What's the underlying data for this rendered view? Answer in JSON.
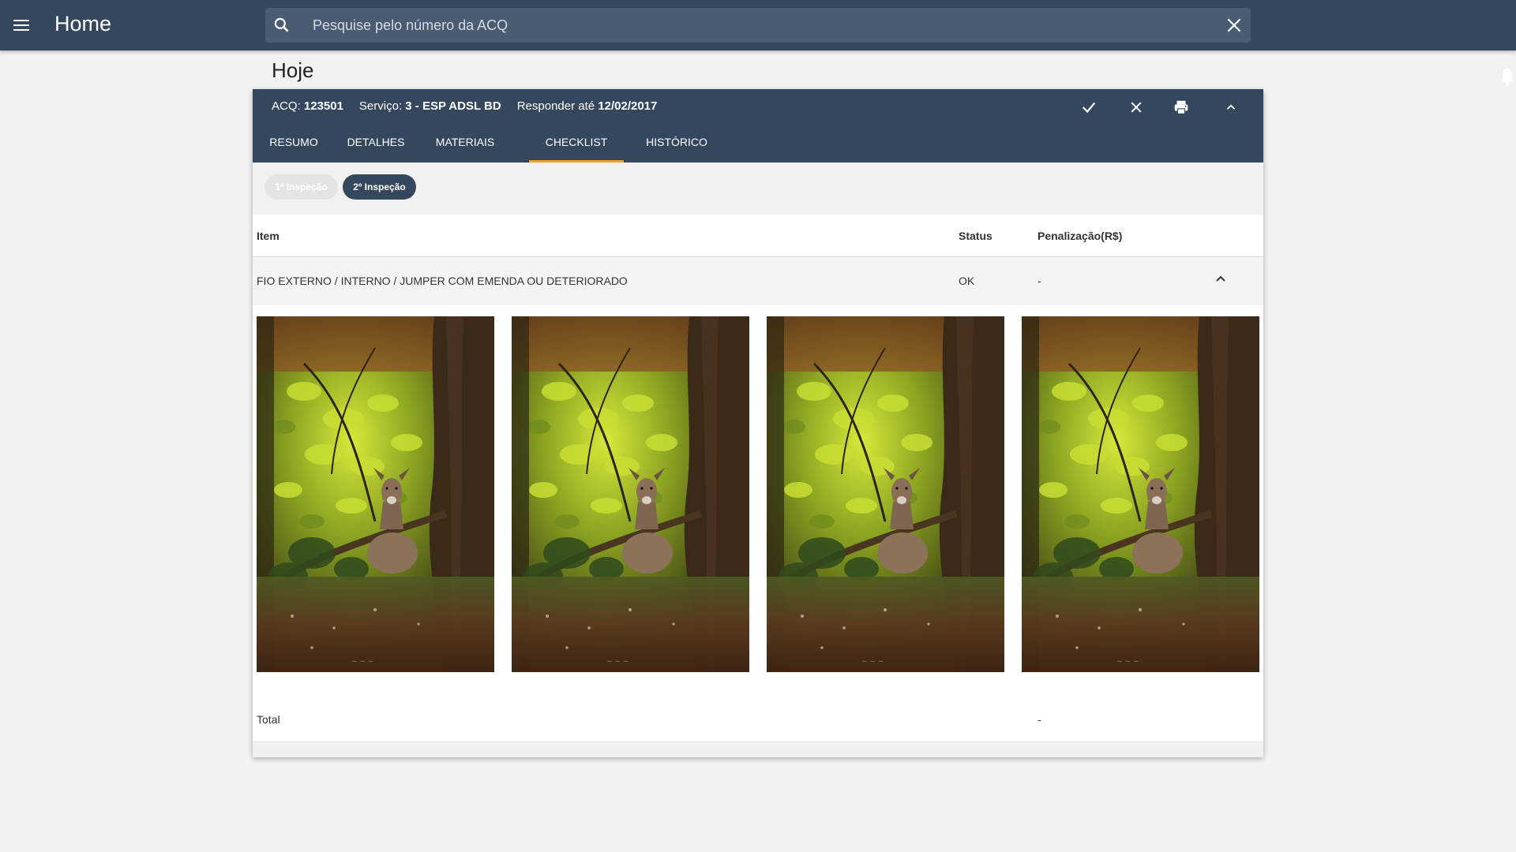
{
  "app": {
    "title": "Home",
    "search_placeholder": "Pesquise pelo número da ACQ",
    "menu_icon": "menu-icon",
    "search_icon": "search-icon",
    "clear_icon": "close-icon",
    "notification_icon": "bell-icon"
  },
  "section": {
    "title": "Hoje"
  },
  "card": {
    "acq_label": "ACQ:",
    "acq_value": "123501",
    "service_label": "Serviço:",
    "service_value": "3 - ESP ADSL BD",
    "deadline_label": "Responder até",
    "deadline_value": "12/02/2017",
    "actions": [
      "check-icon",
      "close-icon",
      "print-icon",
      "chevron-up-icon"
    ],
    "tabs": [
      {
        "label": "RESUMO",
        "active": false
      },
      {
        "label": "DETALHES",
        "active": false
      },
      {
        "label": "MATERIAIS",
        "active": false
      },
      {
        "label": "CHECKLIST",
        "active": true
      },
      {
        "label": "HISTÓRICO",
        "active": false
      }
    ],
    "inspections": [
      {
        "label": "1ª Inspeção",
        "active": false
      },
      {
        "label": "2º Inspeção",
        "active": true
      }
    ],
    "table": {
      "headers": {
        "item": "Item",
        "status": "Status",
        "penalty": "Penalização(R$)"
      },
      "rows": [
        {
          "item": "FIO EXTERNO / INTERNO / JUMPER COM EMENDA OU DETERIORADO",
          "status": "OK",
          "penalty": "-",
          "expanded": true
        }
      ],
      "photo_count": 4,
      "total_label": "Total",
      "total_value": "-"
    }
  },
  "colors": {
    "primary": "#35475d",
    "search_bg": "#4a5c71",
    "tab_indicator": "#f1a127",
    "page_bg": "#f2f2f2"
  }
}
